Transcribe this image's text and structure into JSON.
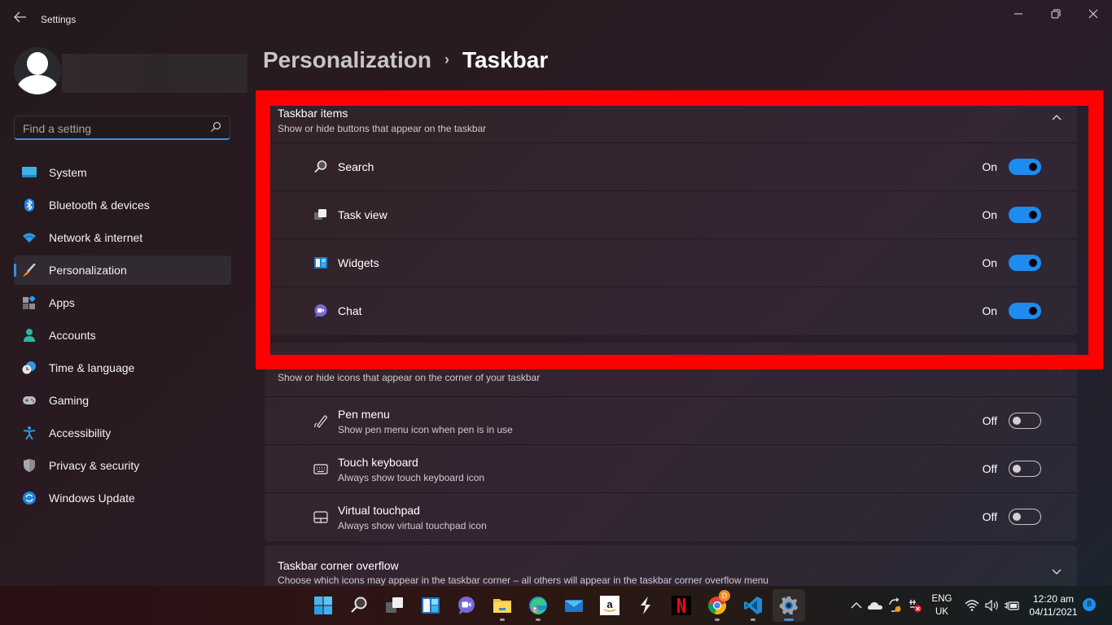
{
  "window": {
    "title": "Settings",
    "controls": {
      "minimize": "—",
      "maximize": "❐",
      "close": "✕"
    },
    "back": "←"
  },
  "search": {
    "placeholder": "Find a setting",
    "value": ""
  },
  "sidebar": {
    "items": [
      {
        "label": "System",
        "icon": "system-icon"
      },
      {
        "label": "Bluetooth & devices",
        "icon": "bluetooth-icon"
      },
      {
        "label": "Network & internet",
        "icon": "wifi-icon"
      },
      {
        "label": "Personalization",
        "icon": "paintbrush-icon",
        "active": true
      },
      {
        "label": "Apps",
        "icon": "apps-icon"
      },
      {
        "label": "Accounts",
        "icon": "accounts-icon"
      },
      {
        "label": "Time & language",
        "icon": "clock-globe-icon"
      },
      {
        "label": "Gaming",
        "icon": "gamepad-icon"
      },
      {
        "label": "Accessibility",
        "icon": "accessibility-icon"
      },
      {
        "label": "Privacy & security",
        "icon": "shield-icon"
      },
      {
        "label": "Windows Update",
        "icon": "update-icon"
      }
    ]
  },
  "breadcrumb": {
    "parent": "Personalization",
    "separator": "›",
    "current": "Taskbar"
  },
  "sections": {
    "taskbar_items": {
      "title": "Taskbar items",
      "subtitle": "Show or hide buttons that appear on the taskbar",
      "expanded": true,
      "rows": [
        {
          "label": "Search",
          "state": "On",
          "on": true,
          "icon": "search-icon"
        },
        {
          "label": "Task view",
          "state": "On",
          "on": true,
          "icon": "task-view-icon"
        },
        {
          "label": "Widgets",
          "state": "On",
          "on": true,
          "icon": "widgets-icon"
        },
        {
          "label": "Chat",
          "state": "On",
          "on": true,
          "icon": "chat-icon"
        }
      ]
    },
    "corner_icons": {
      "title": "",
      "subtitle": "Show or hide icons that appear on the corner of your taskbar",
      "expanded": true,
      "rows": [
        {
          "label": "Pen menu",
          "sub": "Show pen menu icon when pen is in use",
          "state": "Off",
          "on": false,
          "icon": "pen-icon"
        },
        {
          "label": "Touch keyboard",
          "sub": "Always show touch keyboard icon",
          "state": "Off",
          "on": false,
          "icon": "keyboard-icon"
        },
        {
          "label": "Virtual touchpad",
          "sub": "Always show virtual touchpad icon",
          "state": "Off",
          "on": false,
          "icon": "touchpad-icon"
        }
      ]
    },
    "corner_overflow": {
      "title": "Taskbar corner overflow",
      "subtitle": "Choose which icons may appear in the taskbar corner – all others will appear in the taskbar corner overflow menu",
      "expanded": false
    }
  },
  "annotation": {
    "color": "#ff0000"
  },
  "taskbar": {
    "apps": [
      "start",
      "search",
      "task-view",
      "widgets",
      "chat",
      "file-explorer",
      "edge",
      "mail",
      "amazon",
      "app-s",
      "netflix",
      "chrome",
      "vscode",
      "settings"
    ],
    "chrome_badge": "D",
    "tray": {
      "language_line1": "ENG",
      "language_line2": "UK",
      "time": "12:20 am",
      "date": "04/11/2021",
      "notifications": "8"
    }
  },
  "colors": {
    "accent": "#1d8cf0",
    "highlight": "#ff0000"
  }
}
